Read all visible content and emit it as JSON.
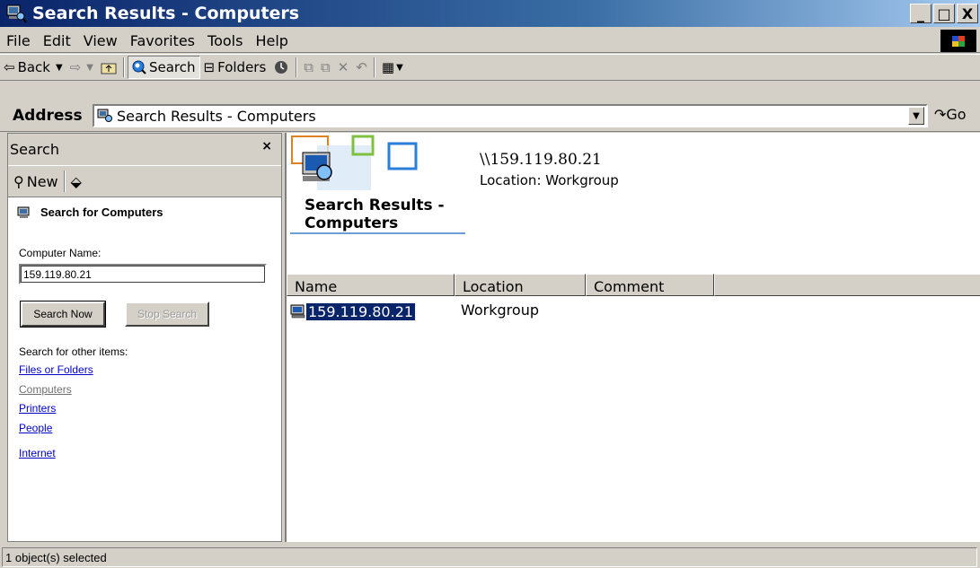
{
  "window": {
    "title": "Search Results - Computers",
    "controls": {
      "minimize": "_",
      "maximize": "□",
      "close": "X"
    }
  },
  "menubar": {
    "items": [
      "File",
      "Edit",
      "View",
      "Favorites",
      "Tools",
      "Help"
    ]
  },
  "toolbar": {
    "back_label": "Back",
    "search_label": "Search",
    "folders_label": "Folders"
  },
  "address": {
    "label": "Address",
    "value": "Search Results - Computers",
    "go_label": "Go"
  },
  "search_pane": {
    "title": "Search",
    "close": "×",
    "new_label": "New",
    "heading": "Search for Computers",
    "computer_name_label": "Computer Name:",
    "computer_name_value": "159.119.80.21",
    "search_now_label": "Search Now",
    "stop_search_label": "Stop Search",
    "other_items_label": "Search for other items:",
    "links": {
      "files": "Files or Folders",
      "computers": "Computers",
      "printers": "Printers",
      "people": "People",
      "internet": "Internet"
    }
  },
  "results": {
    "banner_title_line1": "Search Results -",
    "banner_title_line2": "Computers",
    "selected_path": "\\\\159.119.80.21",
    "selected_location": "Location: Workgroup",
    "columns": {
      "name": "Name",
      "location": "Location",
      "comment": "Comment"
    },
    "rows": [
      {
        "name": "159.119.80.21",
        "location": "Workgroup",
        "comment": ""
      }
    ]
  },
  "status": {
    "text": "1 object(s) selected"
  },
  "colors": {
    "titlebar": "#0a246a",
    "selection": "#0a246a",
    "chrome": "#d4d0c8",
    "link": "#0000cc"
  }
}
